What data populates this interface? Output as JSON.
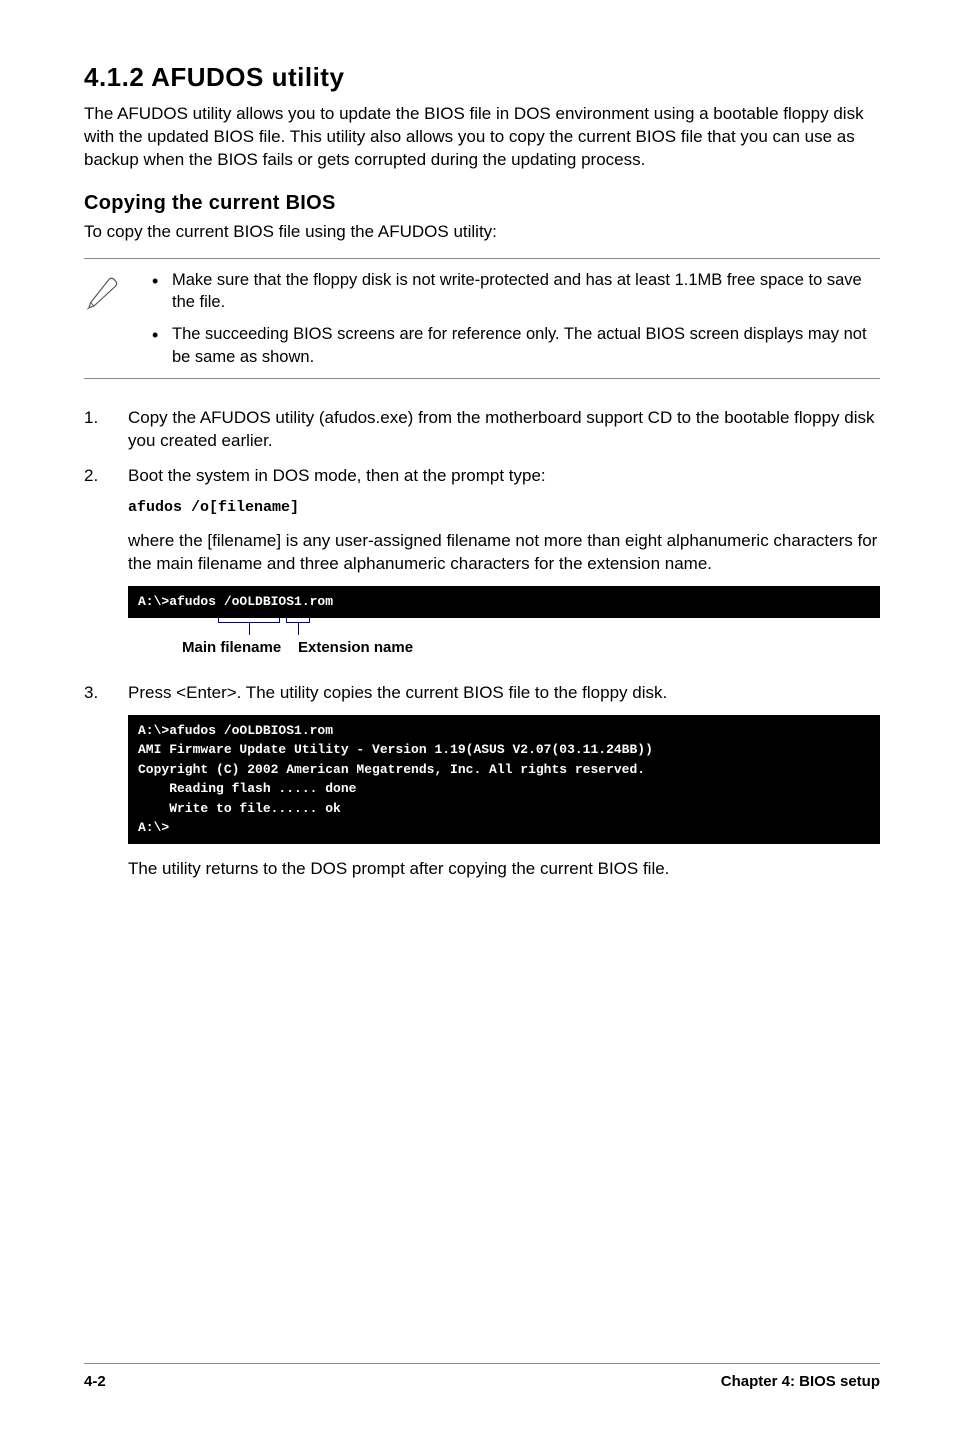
{
  "heading": "4.1.2   AFUDOS utility",
  "intro": "The AFUDOS utility allows you to update the BIOS file in DOS environment using a bootable floppy disk with the updated BIOS file. This utility also allows you to copy the current BIOS file that you can use as backup when the BIOS fails or gets corrupted during the updating process.",
  "subheading": "Copying the current BIOS",
  "subintro": "To copy the current BIOS file using the AFUDOS utility:",
  "notes": [
    "Make sure that the floppy disk is not write-protected and has at least 1.1MB free space to save the file.",
    "The succeeding BIOS screens are for reference only. The actual BIOS screen displays may not be same as shown."
  ],
  "step1": "Copy the AFUDOS utility (afudos.exe) from the motherboard support CD to the bootable floppy disk you created earlier.",
  "step2": "Boot the system in DOS mode, then at the prompt type:",
  "cmd": "afudos /o[filename]",
  "step2b": "where the [filename] is any user-assigned filename not more than eight alphanumeric characters  for the main filename and three alphanumeric characters for the extension name.",
  "term1": "A:\\>afudos /oOLDBIOS1.rom",
  "anno_main": "Main filename",
  "anno_ext": "Extension name",
  "step3": "Press <Enter>. The utility copies the current BIOS file to the floppy disk.",
  "term2": "A:\\>afudos /oOLDBIOS1.rom\nAMI Firmware Update Utility - Version 1.19(ASUS V2.07(03.11.24BB))\nCopyright (C) 2002 American Megatrends, Inc. All rights reserved.\n    Reading flash ..... done\n    Write to file...... ok\nA:\\>",
  "step3b": "The utility returns to the DOS prompt after copying the current BIOS file.",
  "footer_left": "4-2",
  "footer_right": "Chapter 4: BIOS setup"
}
